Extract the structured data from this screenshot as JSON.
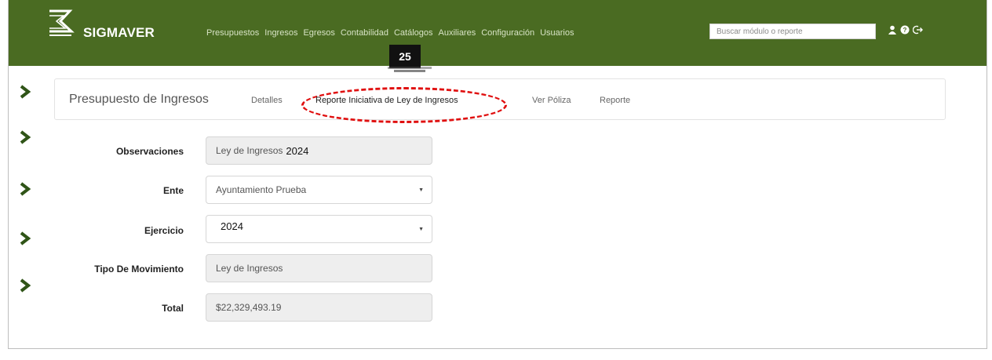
{
  "brand": {
    "name": "SIGMAVER"
  },
  "nav": {
    "items": [
      "Presupuestos",
      "Ingresos",
      "Egresos",
      "Contabilidad",
      "Catálogos",
      "Auxiliares",
      "Configuración",
      "Usuarios"
    ],
    "search_placeholder": "Buscar módulo o reporte",
    "icons": [
      "user-icon",
      "help-icon",
      "logout-icon"
    ]
  },
  "tooltip": {
    "number": "25"
  },
  "subnav": {
    "title": "Presupuesto de Ingresos",
    "links": [
      "Detalles",
      "Reporte Iniciativa de Ley de Ingresos",
      "Ver Póliza",
      "Reporte"
    ],
    "highlighted_index": 1
  },
  "form": {
    "observaciones": {
      "label": "Observaciones",
      "value_prefix": "Ley de Ingresos",
      "value_year": "2024"
    },
    "ente": {
      "label": "Ente",
      "value": "Ayuntamiento Prueba"
    },
    "ejercicio": {
      "label": "Ejercicio",
      "value": "2024"
    },
    "tipo": {
      "label": "Tipo De Movimiento",
      "value": "Ley de Ingresos"
    },
    "total": {
      "label": "Total",
      "value": "$22,329,493.19"
    }
  },
  "colors": {
    "navbar": "#4a6b22",
    "sidebar_arrow": "#2f5417",
    "highlight": "#e01010"
  }
}
